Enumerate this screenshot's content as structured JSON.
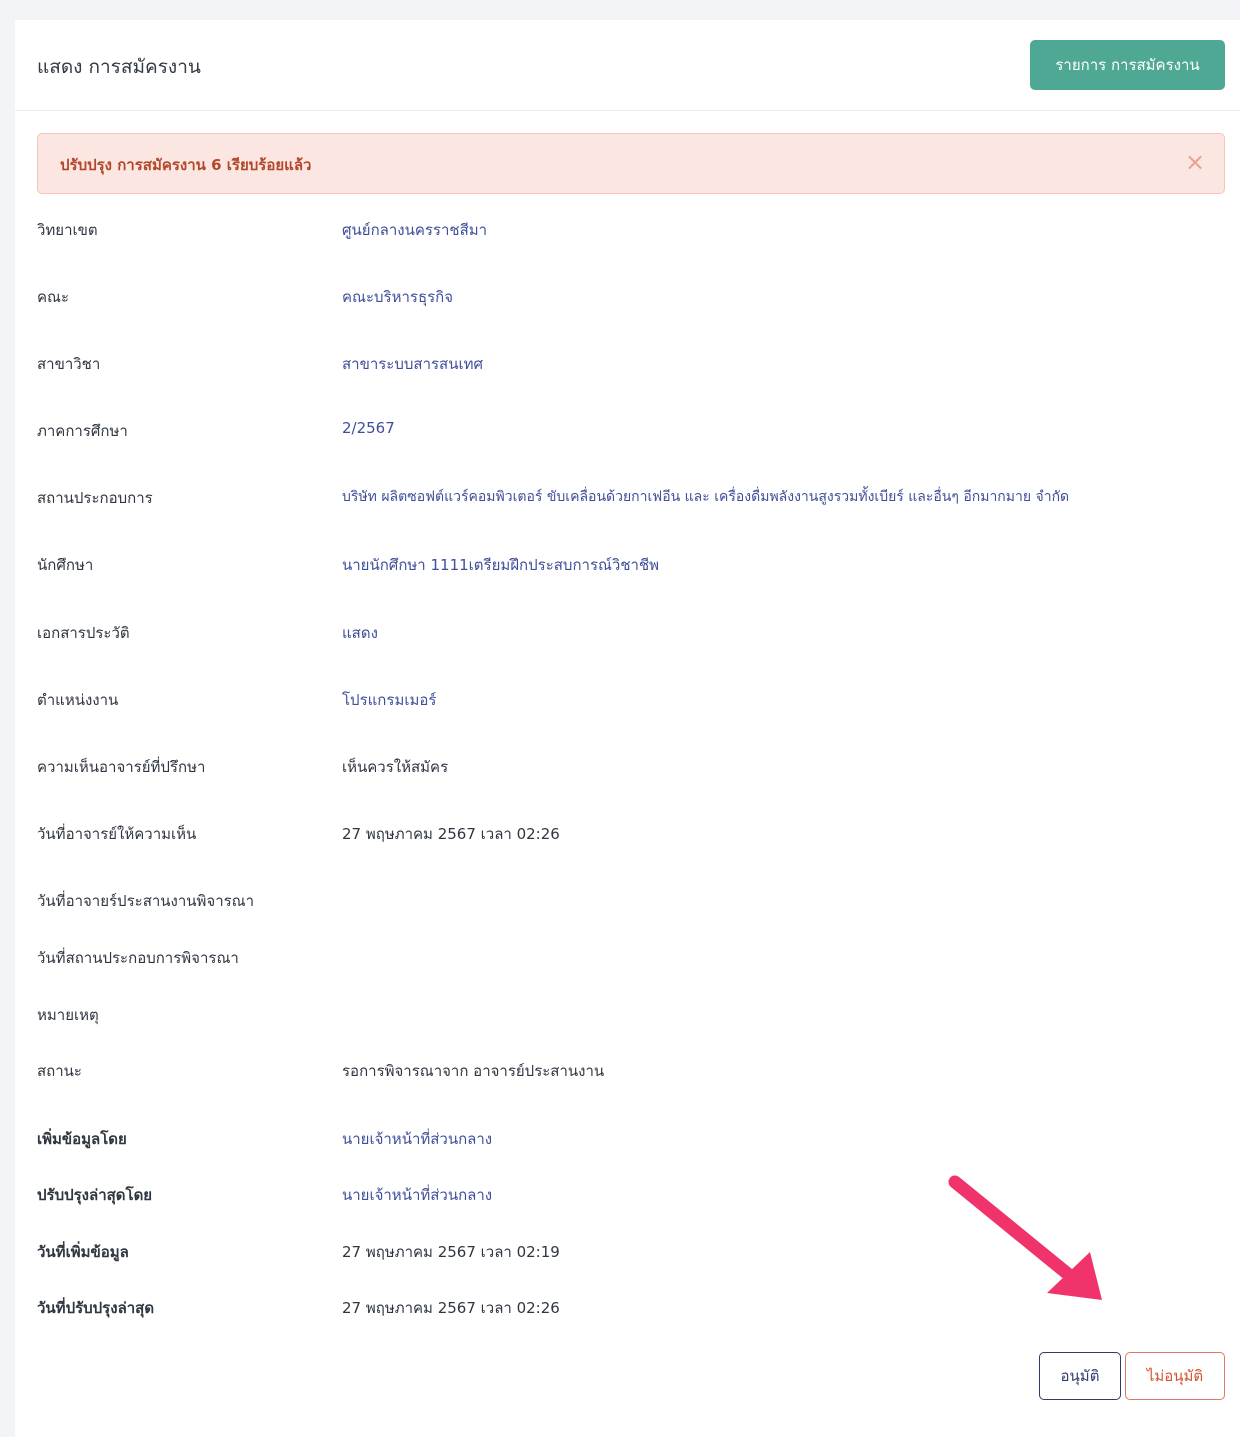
{
  "header": {
    "title": "แสดง การสมัครงาน",
    "list_button": "รายการ การสมัครงาน"
  },
  "alert": {
    "message": "ปรับปรุง การสมัครงาน 6 เรียบร้อยแล้ว",
    "close": "×"
  },
  "fields": [
    {
      "label": "วิทยาเขต",
      "value": "ศูนย์กลางนครราชสีมา"
    },
    {
      "label": "คณะ",
      "value": "คณะบริหารธุรกิจ"
    },
    {
      "label": "สาขาวิชา",
      "value": "สาขาระบบสารสนเทศ"
    },
    {
      "label": "ภาคการศึกษา",
      "value": "2/2567"
    },
    {
      "label": "สถานประกอบการ",
      "value": "บริษัท ผลิตซอฟต์แวร์คอมพิวเตอร์ ขับเคลื่อนด้วยกาเฟอีน และ เครื่องดื่มพลังงานสูงรวมทั้งเบียร์ และอื่นๆ อีกมากมาย จำกัด"
    },
    {
      "label": "นักศึกษา",
      "value": "นายนักศึกษา 1111เตรียมฝึกประสบการณ์วิชาชีพ"
    },
    {
      "label": "เอกสารประวัติ",
      "value": "แสดง"
    },
    {
      "label": "ตำแหน่งงาน",
      "value": "โปรแกรมเมอร์"
    },
    {
      "label": "ความเห็นอาจารย์ที่ปรึกษา",
      "value": "เห็นควรให้สมัคร"
    },
    {
      "label": "วันที่อาจารย์ให้ความเห็น",
      "value": "27 พฤษภาคม 2567 เวลา 02:26"
    },
    {
      "label": "วันที่อาจายร์ประสานงานพิจารณา",
      "value": ""
    },
    {
      "label": "วันที่สถานประกอบการพิจารณา",
      "value": ""
    },
    {
      "label": "หมายเหตุ",
      "value": ""
    },
    {
      "label": "สถานะ",
      "value": "รอการพิจารณาจาก อาจารย์ประสานงาน"
    },
    {
      "label": "เพิ่มข้อมูลโดย",
      "value": "นายเจ้าหน้าที่ส่วนกลาง"
    },
    {
      "label": "ปรับปรุงล่าสุดโดย",
      "value": "นายเจ้าหน้าที่ส่วนกลาง"
    },
    {
      "label": "วันที่เพิ่มข้อมูล",
      "value": "27 พฤษภาคม 2567 เวลา 02:19"
    },
    {
      "label": "วันที่ปรับปรุงล่าสุด",
      "value": "27 พฤษภาคม 2567 เวลา 02:26"
    }
  ],
  "actions": {
    "approve": "อนุมัติ",
    "reject": "ไม่อนุมัติ"
  },
  "colors": {
    "primary_button": "#4fa893",
    "link": "#3f4f9a",
    "alert_bg": "#fbe6e1",
    "alert_text": "#b3472c",
    "arrow": "#f0336b"
  }
}
